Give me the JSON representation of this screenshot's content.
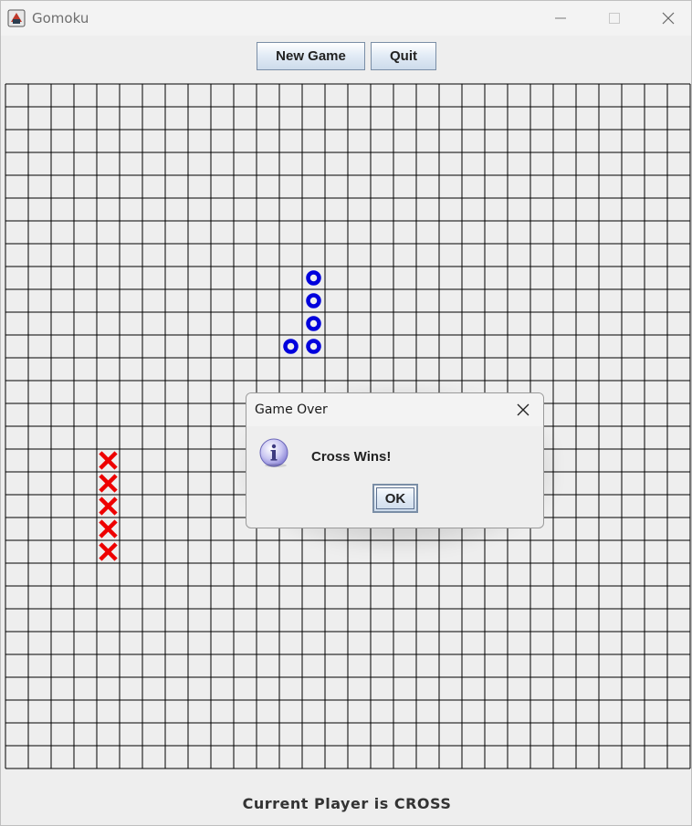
{
  "window": {
    "title": "Gomoku",
    "controls": [
      "minimize",
      "maximize",
      "close"
    ]
  },
  "toolbar": {
    "new_game_label": "New Game",
    "quit_label": "Quit"
  },
  "board": {
    "rows": 30,
    "cols": 30,
    "grid_color": "#000000",
    "background": "#eeeeee",
    "pieces": [
      {
        "type": "nought",
        "row": 8,
        "col": 13
      },
      {
        "type": "nought",
        "row": 9,
        "col": 13
      },
      {
        "type": "nought",
        "row": 10,
        "col": 13
      },
      {
        "type": "nought",
        "row": 11,
        "col": 12
      },
      {
        "type": "nought",
        "row": 11,
        "col": 13
      },
      {
        "type": "cross",
        "row": 16,
        "col": 4
      },
      {
        "type": "cross",
        "row": 17,
        "col": 4
      },
      {
        "type": "cross",
        "row": 18,
        "col": 4
      },
      {
        "type": "cross",
        "row": 19,
        "col": 4
      },
      {
        "type": "cross",
        "row": 20,
        "col": 4
      }
    ],
    "cross_color": "#ee0000",
    "nought_color": "#0000dd"
  },
  "status": {
    "text": "Current Player is CROSS"
  },
  "dialog": {
    "title": "Game Over",
    "message": "Cross Wins!",
    "ok_label": "OK",
    "icon": "info-icon"
  }
}
